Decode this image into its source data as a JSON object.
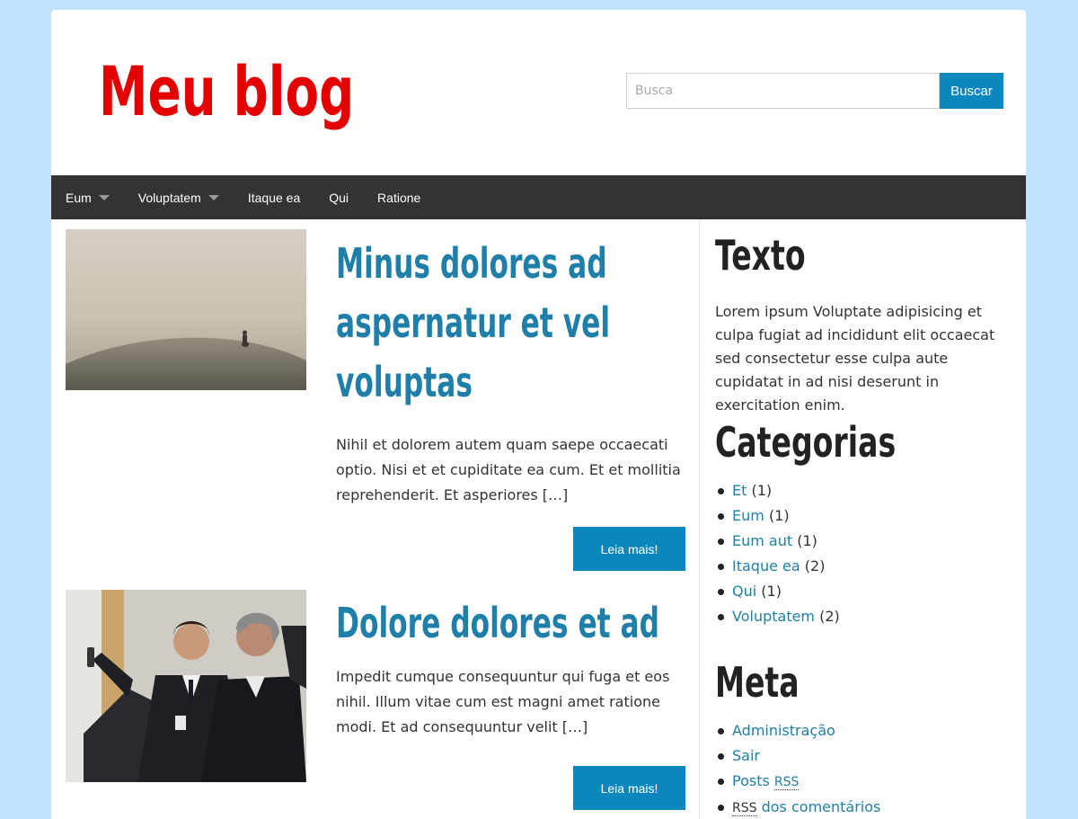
{
  "site": {
    "title": "Meu blog"
  },
  "search": {
    "placeholder": "Busca",
    "value": "",
    "button_label": "Buscar"
  },
  "nav": {
    "items": [
      {
        "label": "Eum",
        "has_dropdown": true
      },
      {
        "label": "Voluptatem",
        "has_dropdown": true
      },
      {
        "label": "Itaque ea",
        "has_dropdown": false
      },
      {
        "label": "Qui",
        "has_dropdown": false
      },
      {
        "label": "Ratione",
        "has_dropdown": false
      }
    ]
  },
  "posts": [
    {
      "title": [
        "Minus dolores ad",
        "aspernatur et vel",
        "voluptas"
      ],
      "excerpt": "Nihil et dolorem autem quam saepe occaecati optio. Nisi et et cupiditate ea cum. Et et mollitia reprehenderit. Et asperiores […]",
      "read_more": "Leia mais!",
      "thumbnail": "foggy-hill-photo"
    },
    {
      "title": [
        "Dolore dolores et ad"
      ],
      "excerpt": "Impedit cumque consequuntur qui fuga et eos nihil. Illum vitae cum est magni amet ratione modi. Et ad consequuntur velit […]",
      "read_more": "Leia mais!",
      "thumbnail": "business-meeting-photo"
    }
  ],
  "sidebar": {
    "texto": {
      "title": "Texto",
      "body": "Lorem ipsum Voluptate adipisicing et culpa fugiat ad incididunt elit occaecat sed consectetur esse culpa aute cupidatat in ad nisi deserunt in exercitation enim."
    },
    "categorias": {
      "title": "Categorias",
      "items": [
        {
          "label": "Et",
          "count": "(1)"
        },
        {
          "label": "Eum",
          "count": "(1)"
        },
        {
          "label": "Eum aut",
          "count": "(1)"
        },
        {
          "label": "Itaque ea",
          "count": "(2)"
        },
        {
          "label": "Qui",
          "count": "(1)"
        },
        {
          "label": "Voluptatem",
          "count": "(2)"
        }
      ]
    },
    "meta": {
      "title": "Meta",
      "items": [
        {
          "prefix": "",
          "label": "Administração",
          "suffix": ""
        },
        {
          "prefix": "",
          "label": "Sair",
          "suffix": ""
        },
        {
          "prefix": "",
          "label": "Posts",
          "suffix": "RSS"
        },
        {
          "prefix": "RSS",
          "label": "dos comentários",
          "suffix": ""
        }
      ]
    }
  },
  "colors": {
    "background": "#bfe3ff",
    "title_red": "#e50000",
    "accent_blue": "#0a87bd",
    "link_blue": "#1f7fa8",
    "navbar": "#333333"
  }
}
